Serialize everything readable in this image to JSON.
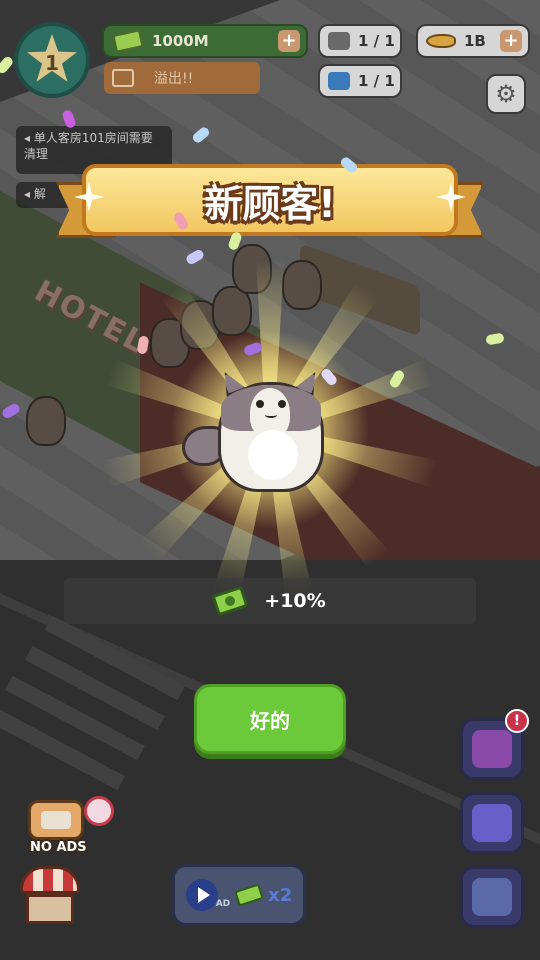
{
  "hud": {
    "level": "1",
    "money": "1000M",
    "overflow_label": "溢出!!",
    "stat_a": "1 / 1",
    "stat_b": "1 / 1",
    "fish": "1B"
  },
  "notices": [
    {
      "text": "单人客房101房间需要清理"
    },
    {
      "text": "解"
    }
  ],
  "scene": {
    "hotel_sign": "HOTEL"
  },
  "popup": {
    "title": "新顾客!",
    "reward": "+10%",
    "ok_label": "好的"
  },
  "bottom": {
    "noads_label": "NO ADS",
    "ad_label": "AD",
    "ad_multiplier": "x2",
    "tasks_badge": "!"
  },
  "colors": {
    "accent_green": "#6cc93a",
    "banner_gold": "#f2c760",
    "alert_red": "#c8334a"
  },
  "icons": [
    "star-level-icon",
    "cash-icon",
    "plus-icon",
    "chart-icon",
    "hammer-icon",
    "ink-icon",
    "fish-icon",
    "gear-icon",
    "speaker-icon",
    "tasks-icon",
    "cat-face-icon",
    "wrench-icon",
    "shop-icon",
    "tv-icon",
    "play-icon"
  ]
}
